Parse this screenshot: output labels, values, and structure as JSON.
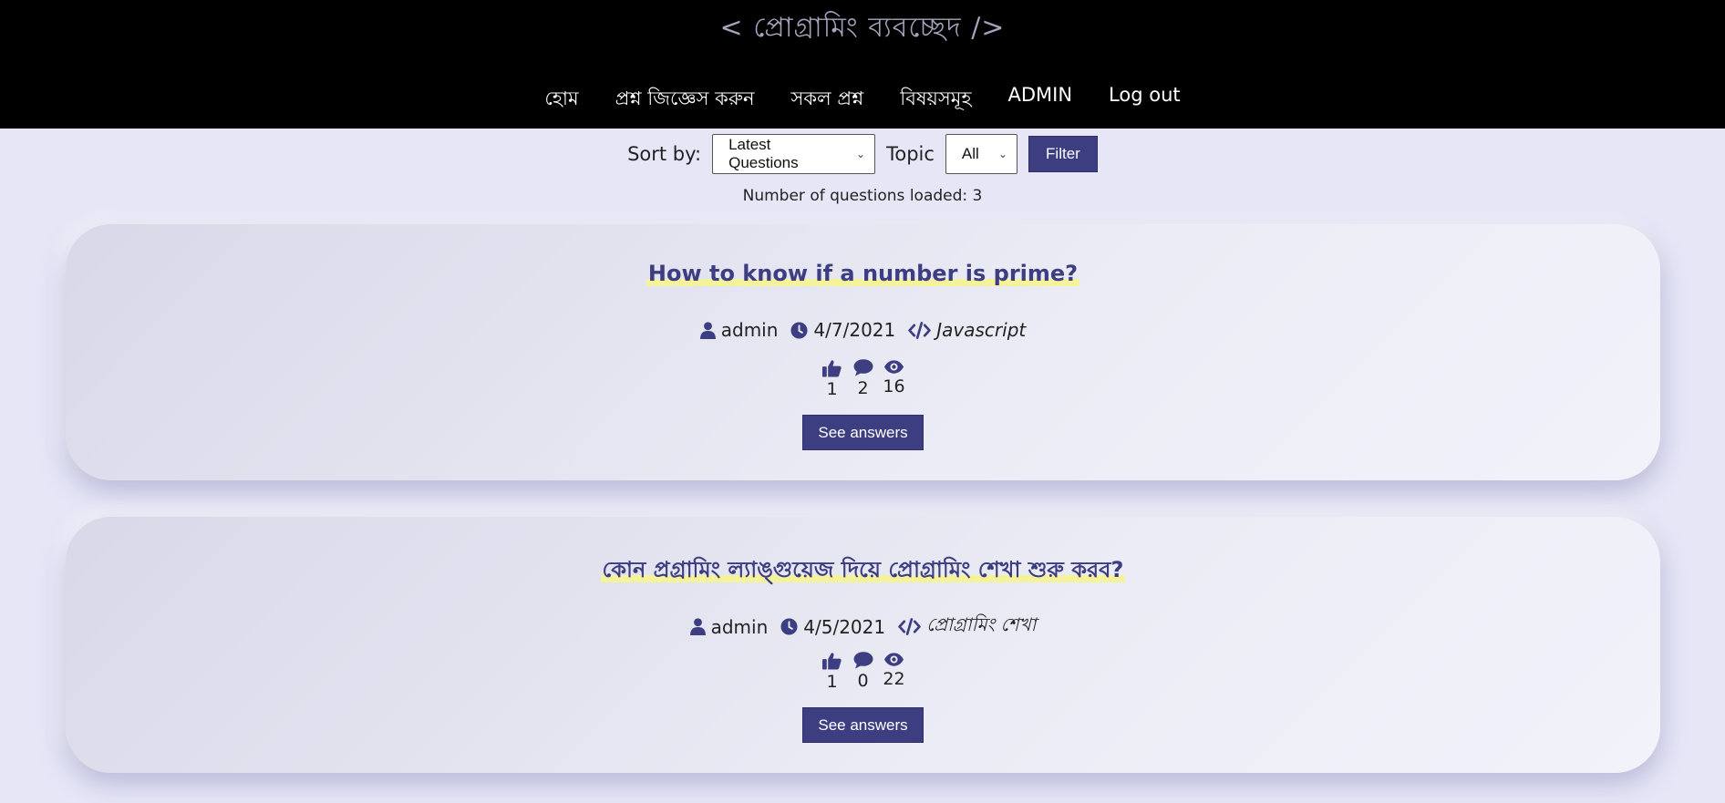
{
  "header": {
    "site_title": "< প্রোগ্রামিং ব্যবচ্ছেদ />",
    "nav": [
      {
        "label": "হোম"
      },
      {
        "label": "প্রশ্ন জিজ্ঞেস করুন"
      },
      {
        "label": "সকল প্রশ্ন"
      },
      {
        "label": "বিষয়সমূহ"
      },
      {
        "label": "ADMIN"
      },
      {
        "label": "Log out"
      }
    ]
  },
  "filters": {
    "sort_label": "Sort by:",
    "sort_value": "Latest Questions",
    "topic_label": "Topic",
    "topic_value": "All",
    "filter_button": "Filter"
  },
  "count_text": "Number of questions loaded: 3",
  "questions": [
    {
      "title": "How to know if a number is prime?",
      "author": "admin",
      "date": "4/7/2021",
      "topic": "Javascript",
      "likes": "1",
      "comments": "2",
      "views": "16",
      "button": "See answers"
    },
    {
      "title": "কোন প্রগ্রামিং ল্যাঙ্গুয়েজ দিয়ে প্রোগ্রামিং শেখা শুরু করব?",
      "author": "admin",
      "date": "4/5/2021",
      "topic": "প্রোগ্রামিং শেখা",
      "likes": "1",
      "comments": "0",
      "views": "22",
      "button": "See answers"
    }
  ],
  "icons": {
    "user": "user-icon",
    "clock": "clock-icon",
    "code": "code-icon",
    "like": "thumbs-up-icon",
    "comment": "comment-icon",
    "view": "eye-icon"
  },
  "colors": {
    "accent": "#3d3d82",
    "header_bg": "#000000",
    "page_bg": "#e6e6f7",
    "highlight": "#f4f29a"
  }
}
